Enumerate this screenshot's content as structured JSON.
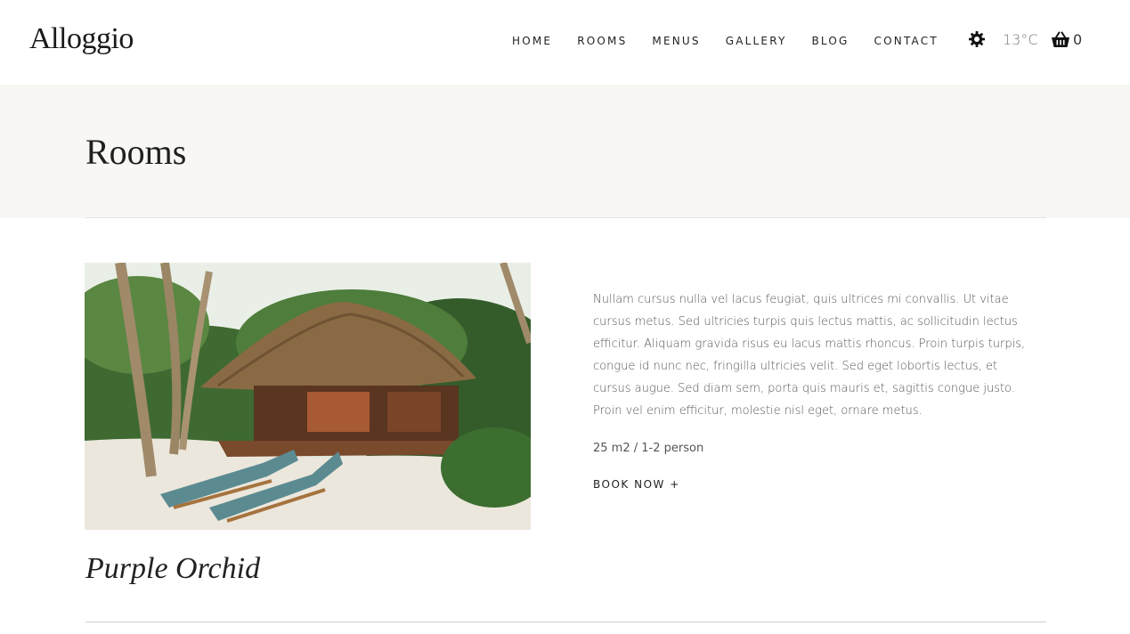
{
  "site": {
    "logo": "Alloggio"
  },
  "scroll_progress": 0.2,
  "nav": {
    "items": [
      {
        "label": "HOME"
      },
      {
        "label": "ROOMS"
      },
      {
        "label": "MENUS"
      },
      {
        "label": "GALLERY"
      },
      {
        "label": "BLOG"
      },
      {
        "label": "CONTACT"
      }
    ]
  },
  "header_tools": {
    "weather_icon": "gear-icon",
    "temperature_value": "13",
    "temperature_unit": "°C",
    "cart_icon": "basket-icon",
    "cart_count": "0"
  },
  "page": {
    "title": "Rooms"
  },
  "room": {
    "name": "Purple Orchid",
    "description": "Nullam cursus nulla vel lacus feugiat, quis ultrices mi convallis. Ut vitae cursus metus. Sed ultricies turpis quis lectus mattis, ac sollicitudin lectus efficitur. Aliquam gravida risus eu lacus mattis rhoncus. Proin turpis turpis, congue id nunc nec, fringilla ultricies velit. Sed eget lobortis lectus, et cursus augue. Sed diam sem, porta quis mauris et, sagittis congue justo. Proin vel enim efficitur, molestie nisl eget, ornare metus.",
    "meta": "25 m2 / 1-2 person",
    "cta": "BOOK NOW +"
  },
  "colors": {
    "accent": "#2a5c8a",
    "hero_background": "#f8f7f3"
  }
}
